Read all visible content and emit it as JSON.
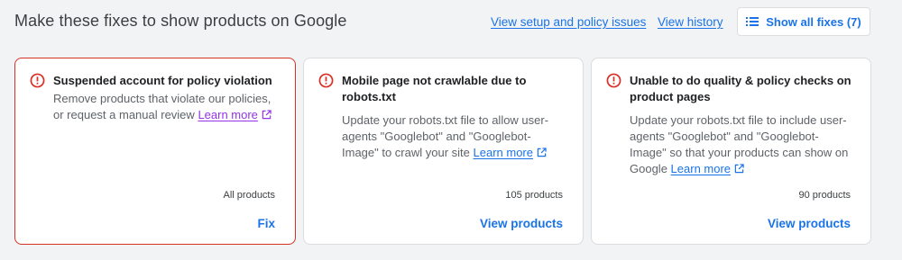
{
  "header": {
    "title": "Make these fixes to show products on Google",
    "link_setup": "View setup and policy issues",
    "link_history": "View history",
    "show_all_label": "Show all fixes (7)"
  },
  "icons": {
    "error": "error-circle-icon",
    "external": "open-in-new-icon",
    "list": "list-icon"
  },
  "colors": {
    "accent": "#1a73e8",
    "error": "#d93025",
    "visited_link": "#9334e6"
  },
  "cards": [
    {
      "title": "Suspended account for policy violation",
      "description": "Remove products that violate our policies, or request a manual review",
      "learn_more": "Learn more",
      "count": "All products",
      "action": "Fix"
    },
    {
      "title": "Mobile page not crawlable due to robots.txt",
      "description": "Update your robots.txt file to allow user-agents \"Googlebot\" and \"Googlebot-Image\" to crawl your site",
      "learn_more": "Learn more",
      "count": "105 products",
      "action": "View products"
    },
    {
      "title": "Unable to do quality & policy checks on product pages",
      "description": "Update your robots.txt file to include user-agents \"Googlebot\" and \"Googlebot-Image\" so that your products can show on Google",
      "learn_more": "Learn more",
      "count": "90 products",
      "action": "View products"
    }
  ]
}
